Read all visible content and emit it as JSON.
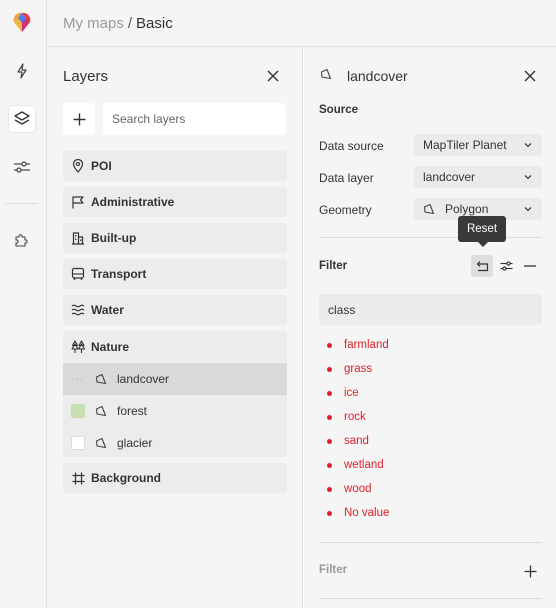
{
  "breadcrumb": {
    "parent": "My maps",
    "separator": "/",
    "current": "Basic"
  },
  "rail": {
    "items": [
      {
        "icon": "lightning-icon"
      },
      {
        "icon": "layers-icon",
        "active": true
      },
      {
        "icon": "sliders-icon"
      },
      {
        "icon": "puzzle-icon"
      }
    ]
  },
  "layers_panel": {
    "title": "Layers",
    "search_placeholder": "Search layers",
    "groups": [
      {
        "label": "POI",
        "icon": "pin-icon"
      },
      {
        "label": "Administrative",
        "icon": "flag-icon"
      },
      {
        "label": "Built-up",
        "icon": "buildings-icon"
      },
      {
        "label": "Transport",
        "icon": "bus-icon"
      },
      {
        "label": "Water",
        "icon": "waves-icon"
      },
      {
        "label": "Nature",
        "icon": "trees-icon",
        "expanded": true
      },
      {
        "label": "Background",
        "icon": "frame-icon"
      }
    ],
    "nature_layers": [
      {
        "label": "landcover",
        "selected": true,
        "color": null
      },
      {
        "label": "forest",
        "selected": false,
        "color": "#c7dfb3"
      },
      {
        "label": "glacier",
        "selected": false,
        "color": "#ffffff"
      }
    ]
  },
  "properties_panel": {
    "title": "landcover",
    "source_heading": "Source",
    "fields": [
      {
        "label": "Data source",
        "value": "MapTiler Planet"
      },
      {
        "label": "Data layer",
        "value": "landcover"
      },
      {
        "label": "Geometry",
        "value": "Polygon"
      }
    ],
    "filter_heading": "Filter",
    "tooltip": "Reset",
    "filter_field": "class",
    "filter_values": [
      "farmland",
      "grass",
      "ice",
      "rock",
      "sand",
      "wetland",
      "wood",
      "No value"
    ],
    "second_filter_heading": "Filter"
  },
  "colors": {
    "accent_red": "#e0202a",
    "panel_bg": "#f5f5f5",
    "forest_swatch": "#c7dfb3"
  }
}
